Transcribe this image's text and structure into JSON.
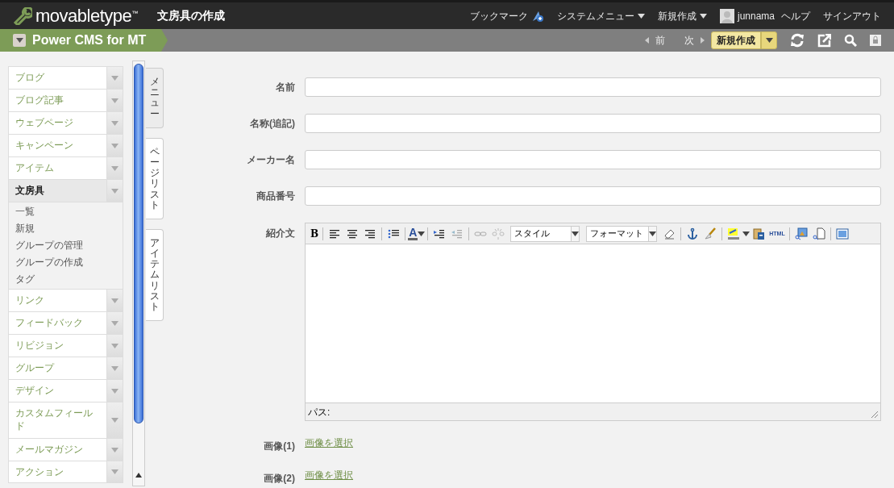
{
  "header": {
    "logo": "movabletype",
    "logo_mark": "™",
    "title": "文房具の作成",
    "menu": [
      {
        "label": "ブックマーク",
        "kind": "bookmark"
      },
      {
        "label": "システムメニュー",
        "kind": "dropdown"
      },
      {
        "label": "新規作成",
        "kind": "dropdown"
      },
      {
        "label": "junnama",
        "kind": "user"
      },
      {
        "label": "ヘルプ",
        "kind": "link"
      },
      {
        "label": "サインアウト",
        "kind": "link"
      }
    ]
  },
  "site_bar": {
    "site": "Power CMS for MT",
    "prev": "前",
    "next": "次",
    "create_button": "新規作成"
  },
  "sidebar": {
    "items": [
      {
        "label": "ブログ",
        "expanded": false
      },
      {
        "label": "ブログ記事",
        "expanded": false
      },
      {
        "label": "ウェブページ",
        "expanded": false
      },
      {
        "label": "キャンペーン",
        "expanded": false
      },
      {
        "label": "アイテム",
        "expanded": false
      },
      {
        "label": "文房具",
        "expanded": true,
        "children": [
          {
            "label": "一覧"
          },
          {
            "label": "新規"
          },
          {
            "label": "グループの管理"
          },
          {
            "label": "グループの作成"
          },
          {
            "label": "タグ"
          }
        ]
      },
      {
        "label": "リンク",
        "expanded": false
      },
      {
        "label": "フィードバック",
        "expanded": false
      },
      {
        "label": "リビジョン",
        "expanded": false
      },
      {
        "label": "グループ",
        "expanded": false
      },
      {
        "label": "デザイン",
        "expanded": false
      },
      {
        "label": "カスタムフィールド",
        "expanded": false
      },
      {
        "label": "メールマガジン",
        "expanded": false
      },
      {
        "label": "アクション",
        "expanded": false
      }
    ]
  },
  "side_tabs": [
    {
      "label": "メニュー",
      "selected": true
    },
    {
      "label": "ページリスト",
      "selected": false
    },
    {
      "label": "アイテムリスト",
      "selected": false
    }
  ],
  "form": {
    "fields": [
      {
        "label": "名前",
        "kind": "text"
      },
      {
        "label": "名称(追記)",
        "kind": "text"
      },
      {
        "label": "メーカー名",
        "kind": "text"
      },
      {
        "label": "商品番号",
        "kind": "text"
      },
      {
        "label": "紹介文",
        "kind": "editor"
      },
      {
        "label": "画像(1)",
        "kind": "image",
        "link": "画像を選択"
      },
      {
        "label": "画像(2)",
        "kind": "image",
        "link": "画像を選択"
      }
    ],
    "editor": {
      "bold": "B",
      "font_color": "A",
      "style_select": "スタイル",
      "format_select": "フォーマット",
      "html_button": "HTML",
      "path": "パス:"
    }
  }
}
